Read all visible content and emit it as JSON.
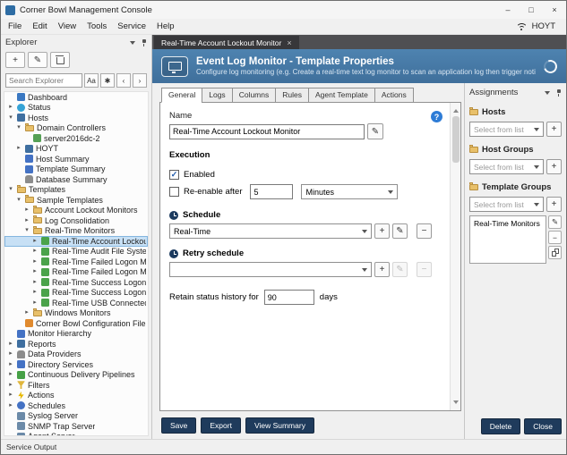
{
  "window": {
    "title": "Corner Bowl Management Console",
    "controls": {
      "minimize": "–",
      "maximize": "□",
      "close": "×"
    }
  },
  "icons": {
    "plus": "+",
    "minus": "−",
    "pencil": "✎",
    "check": "✓",
    "help": "?",
    "close": "×"
  },
  "menu": {
    "items": [
      "File",
      "Edit",
      "View",
      "Tools",
      "Service",
      "Help"
    ],
    "user": "HOYT"
  },
  "explorer": {
    "title": "Explorer",
    "search_placeholder": "Search Explorer",
    "search_buttons": [
      {
        "label": "Aa",
        "name": "match-case-button"
      },
      {
        "label": "✱",
        "name": "wildcard-button"
      },
      {
        "label": "‹",
        "name": "find-previous-button"
      },
      {
        "label": "›",
        "name": "find-next-button"
      }
    ],
    "tree": [
      {
        "label": "Dashboard",
        "level": 0,
        "chev": null,
        "icon": "dashboard"
      },
      {
        "label": "Status",
        "level": 0,
        "chev": "r",
        "icon": "status"
      },
      {
        "label": "Hosts",
        "level": 0,
        "chev": "d",
        "icon": "hosts"
      },
      {
        "label": "Domain Controllers",
        "level": 1,
        "chev": "d",
        "icon": "folder"
      },
      {
        "label": "server2016dc-2",
        "level": 2,
        "chev": null,
        "icon": "server"
      },
      {
        "label": "HOYT",
        "level": 1,
        "chev": "r",
        "icon": "computer"
      },
      {
        "label": "Host Summary",
        "level": 1,
        "chev": null,
        "icon": "chart"
      },
      {
        "label": "Template Summary",
        "level": 1,
        "chev": null,
        "icon": "chart"
      },
      {
        "label": "Database Summary",
        "level": 1,
        "chev": null,
        "icon": "database"
      },
      {
        "label": "Templates",
        "level": 0,
        "chev": "d",
        "icon": "folder"
      },
      {
        "label": "Sample Templates",
        "level": 1,
        "chev": "d",
        "icon": "folder"
      },
      {
        "label": "Account Lockout Monitors",
        "level": 2,
        "chev": "r",
        "icon": "folder"
      },
      {
        "label": "Log Consolidation",
        "level": 2,
        "chev": "r",
        "icon": "folder"
      },
      {
        "label": "Real-Time Monitors",
        "level": 2,
        "chev": "d",
        "icon": "folder"
      },
      {
        "label": "Real-Time Account Lockout Monito",
        "level": 3,
        "chev": "r",
        "icon": "template",
        "sel": true
      },
      {
        "label": "Real-Time Audit File System",
        "level": 3,
        "chev": "r",
        "icon": "template"
      },
      {
        "label": "Real-Time Failed Logon Monitor",
        "level": 3,
        "chev": "r",
        "icon": "template"
      },
      {
        "label": "Real-Time Failed Logon Monitor wit",
        "level": 3,
        "chev": "r",
        "icon": "template"
      },
      {
        "label": "Real-Time Success Logon Monitor",
        "level": 3,
        "chev": "r",
        "icon": "template"
      },
      {
        "label": "Real-Time Success Logon Monitor v",
        "level": 3,
        "chev": "r",
        "icon": "template"
      },
      {
        "label": "Real-Time USB Connected/Disconn",
        "level": 3,
        "chev": "r",
        "icon": "template"
      },
      {
        "label": "Windows Monitors",
        "level": 2,
        "chev": "r",
        "icon": "folder"
      },
      {
        "label": "Corner Bowl Configuration File Backup",
        "level": 1,
        "chev": null,
        "icon": "config"
      },
      {
        "label": "Monitor Hierarchy",
        "level": 0,
        "chev": null,
        "icon": "hierarchy"
      },
      {
        "label": "Reports",
        "level": 0,
        "chev": "r",
        "icon": "report"
      },
      {
        "label": "Data Providers",
        "level": 0,
        "chev": "r",
        "icon": "database"
      },
      {
        "label": "Directory Services",
        "level": 0,
        "chev": "r",
        "icon": "directory"
      },
      {
        "label": "Continuous Delivery Pipelines",
        "level": 0,
        "chev": "r",
        "icon": "pipeline"
      },
      {
        "label": "Filters",
        "level": 0,
        "chev": "r",
        "icon": "filter"
      },
      {
        "label": "Actions",
        "level": 0,
        "chev": "r",
        "icon": "action"
      },
      {
        "label": "Schedules",
        "level": 0,
        "chev": "r",
        "icon": "schedule"
      },
      {
        "label": "Syslog Server",
        "level": 0,
        "chev": null,
        "icon": "syslog"
      },
      {
        "label": "SNMP Trap Server",
        "level": 0,
        "chev": null,
        "icon": "snmp"
      },
      {
        "label": "Agent Server",
        "level": 0,
        "chev": null,
        "icon": "agent"
      }
    ]
  },
  "doc_tab": {
    "label": "Real-Time Account Lockout Monitor"
  },
  "banner": {
    "title": "Event Log Monitor - Template Properties",
    "subtitle": "Configure log monitoring (e.g. Create a real-time text log monitor to scan an application log then trigger notifications w..."
  },
  "tabs": [
    "General",
    "Logs",
    "Columns",
    "Rules",
    "Agent Template",
    "Actions"
  ],
  "active_tab": "General",
  "form": {
    "name_label": "Name",
    "name_value": "Real-Time Account Lockout Monitor",
    "execution_label": "Execution",
    "enabled_label": "Enabled",
    "enabled_checked": true,
    "reenable_label": "Re-enable after",
    "reenable_checked": false,
    "reenable_value": "5",
    "reenable_unit": "Minutes",
    "schedule_label": "Schedule",
    "schedule_value": "Real-Time",
    "retry_label": "Retry schedule",
    "retry_value": "",
    "retain_label": "Retain status history for",
    "retain_value": "90",
    "retain_suffix": "days"
  },
  "footer_buttons": [
    "Save",
    "Export",
    "View Summary"
  ],
  "assignments": {
    "title": "Assignments",
    "sections": [
      {
        "label": "Hosts",
        "placeholder": "Select from list",
        "items": null
      },
      {
        "label": "Host Groups",
        "placeholder": "Select from list",
        "items": null
      },
      {
        "label": "Template Groups",
        "placeholder": "Select from list",
        "items": [
          "Real-Time Monitors"
        ]
      }
    ],
    "buttons": [
      "Delete",
      "Close"
    ]
  },
  "status_bar": "Service Output"
}
